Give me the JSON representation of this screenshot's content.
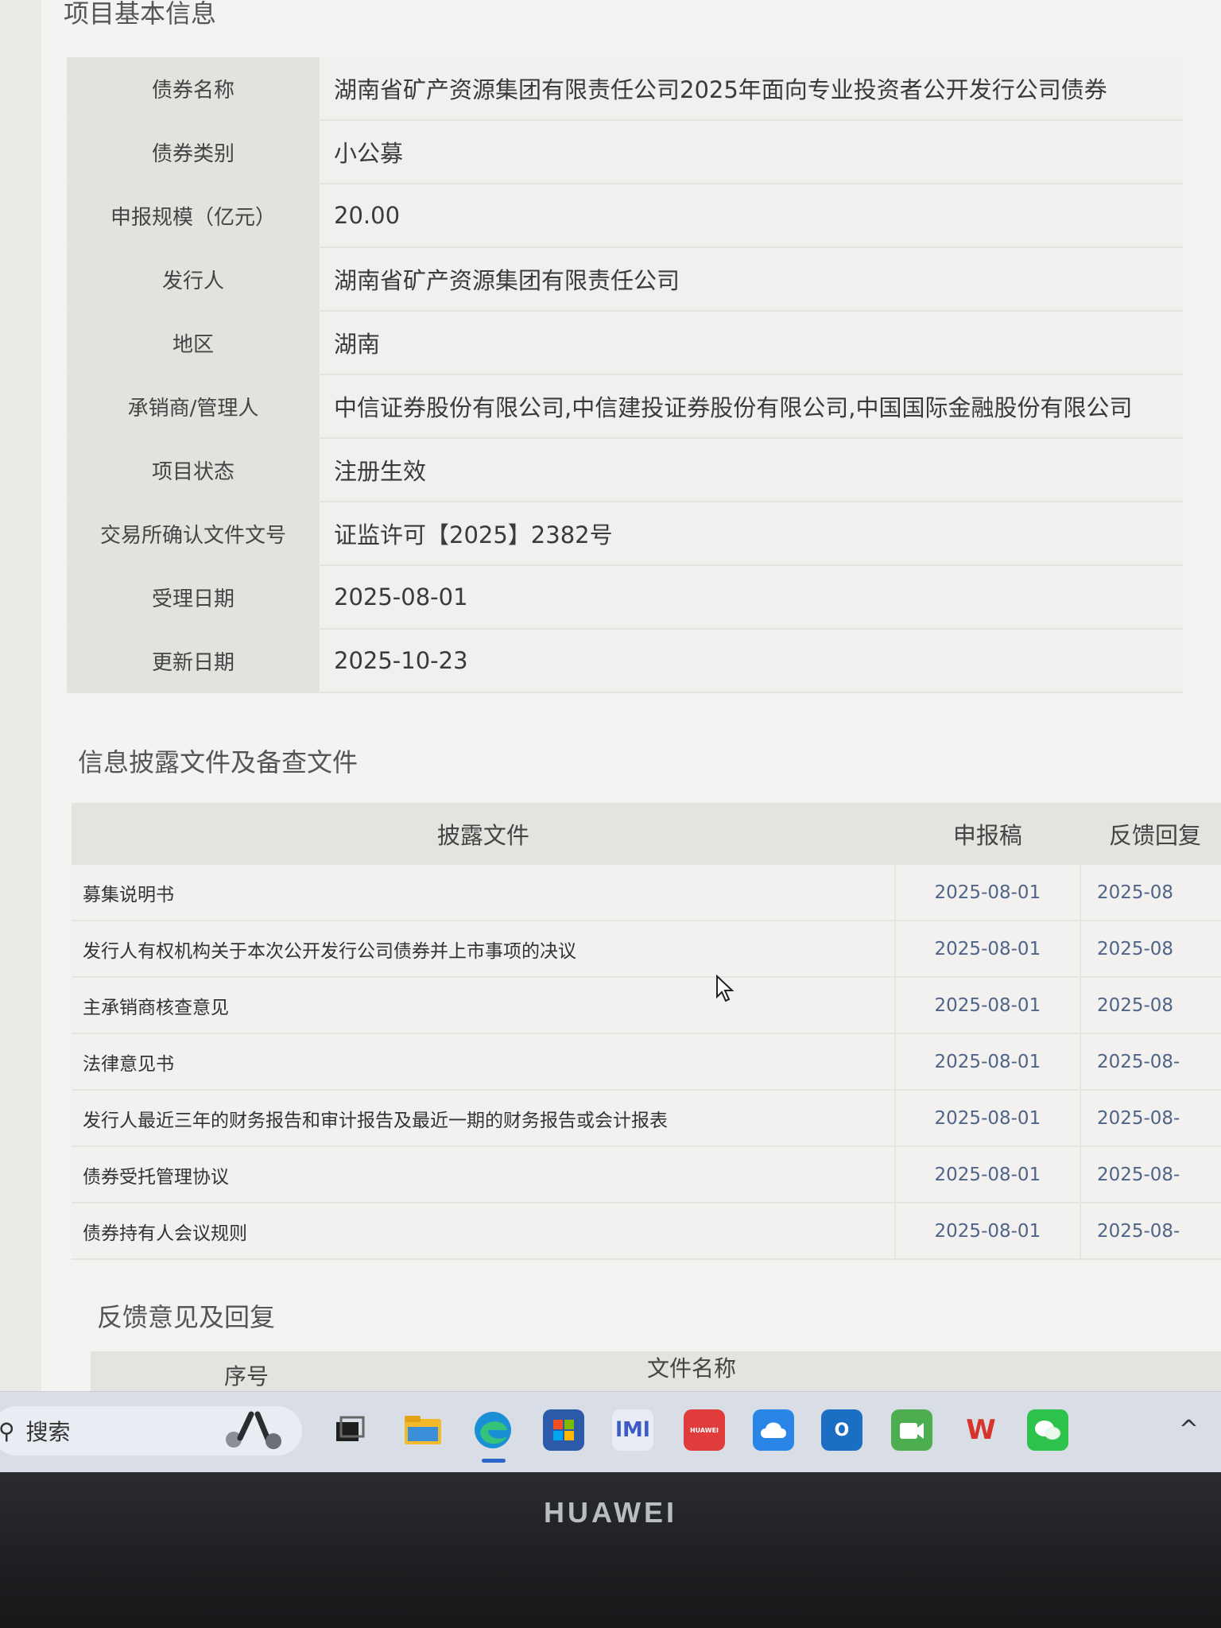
{
  "info_section": {
    "title": "项目基本信息",
    "rows": [
      {
        "label": "债券名称",
        "value": "湖南省矿产资源集团有限责任公司2025年面向专业投资者公开发行公司债券"
      },
      {
        "label": "债券类别",
        "value": "小公募"
      },
      {
        "label": "申报规模（亿元）",
        "value": "20.00"
      },
      {
        "label": "发行人",
        "value": "湖南省矿产资源集团有限责任公司"
      },
      {
        "label": "地区",
        "value": "湖南"
      },
      {
        "label": "承销商/管理人",
        "value": "中信证券股份有限公司,中信建投证券股份有限公司,中国国际金融股份有限公司"
      },
      {
        "label": "项目状态",
        "value": "注册生效"
      },
      {
        "label": "交易所确认文件文号",
        "value": "证监许可【2025】2382号"
      },
      {
        "label": "受理日期",
        "value": "2025-08-01"
      },
      {
        "label": "更新日期",
        "value": "2025-10-23"
      }
    ]
  },
  "disclosure_section": {
    "title": "信息披露文件及备查文件",
    "headers": [
      "披露文件",
      "申报稿",
      "反馈回复"
    ],
    "rows": [
      {
        "file": "募集说明书",
        "draft": "2025-08-01",
        "reply": "2025-08"
      },
      {
        "file": "发行人有权机构关于本次公开发行公司债券并上市事项的决议",
        "draft": "2025-08-01",
        "reply": "2025-08"
      },
      {
        "file": "主承销商核查意见",
        "draft": "2025-08-01",
        "reply": "2025-08"
      },
      {
        "file": "法律意见书",
        "draft": "2025-08-01",
        "reply": "2025-08-"
      },
      {
        "file": "发行人最近三年的财务报告和审计报告及最近一期的财务报告或会计报表",
        "draft": "2025-08-01",
        "reply": "2025-08-"
      },
      {
        "file": "债券受托管理协议",
        "draft": "2025-08-01",
        "reply": "2025-08-"
      },
      {
        "file": "债券持有人会议规则",
        "draft": "2025-08-01",
        "reply": "2025-08-"
      }
    ]
  },
  "feedback_section": {
    "title": "反馈意见及回复",
    "headers": [
      "序号",
      "文件名称"
    ]
  },
  "taskbar": {
    "search_label": "搜索",
    "icons": [
      "widgets-icon",
      "task-view-icon",
      "file-explorer-icon",
      "edge-icon",
      "store-icon",
      "app-icon",
      "huawei-appgallery-icon",
      "cloud-icon",
      "outlook-icon",
      "meeting-icon",
      "wps-icon",
      "wechat-icon"
    ],
    "huawei_icon_text": "HUAWEI",
    "overflow_chevron": "^"
  },
  "laptop": {
    "brand": "HUAWEI"
  }
}
